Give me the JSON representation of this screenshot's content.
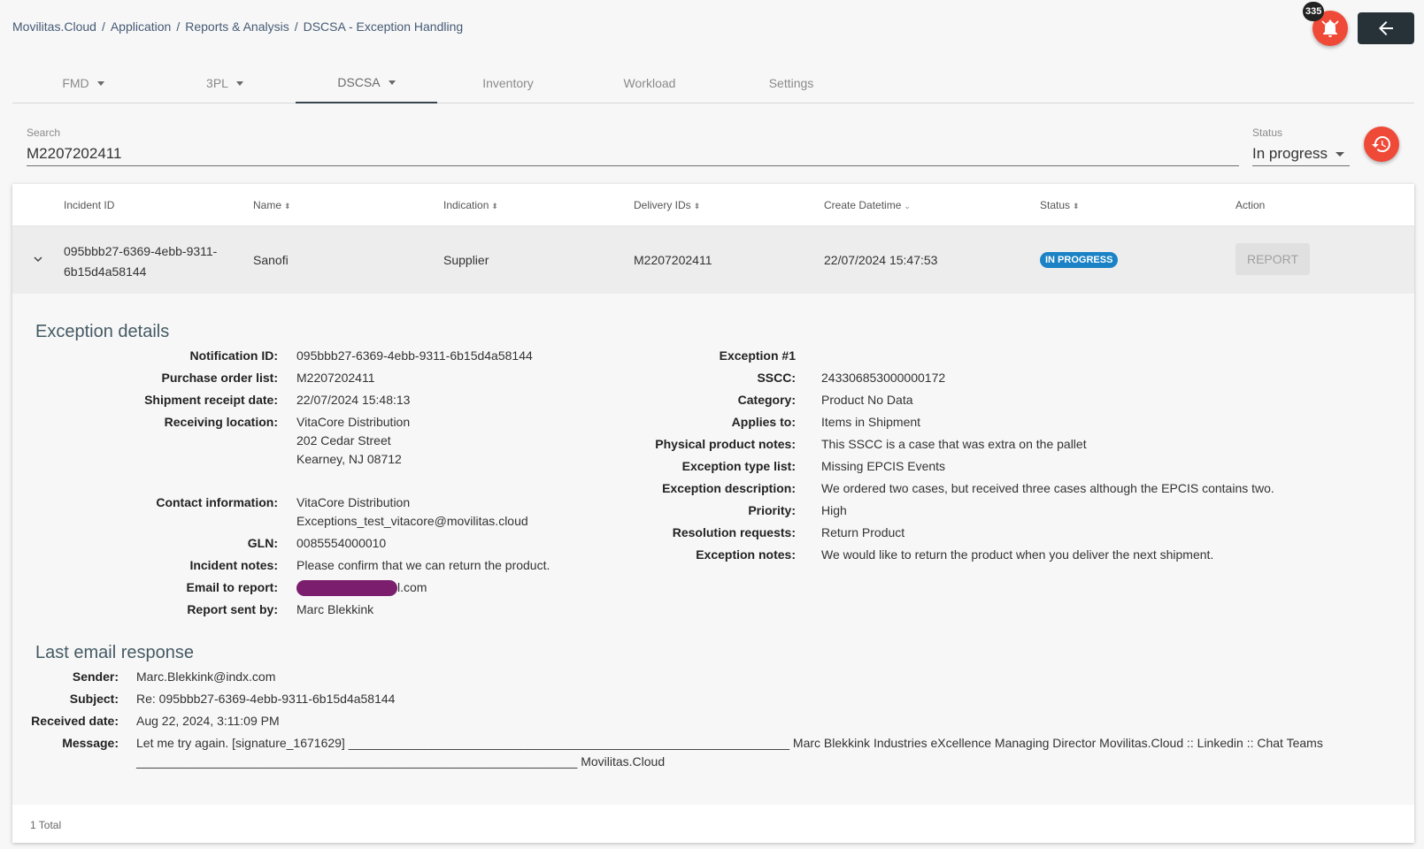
{
  "breadcrumb": [
    "Movilitas.Cloud",
    "Application",
    "Reports & Analysis",
    "DSCSA - Exception Handling"
  ],
  "notifications": {
    "count": "335"
  },
  "tabs": [
    {
      "label": "FMD"
    },
    {
      "label": "3PL"
    },
    {
      "label": "DSCSA"
    },
    {
      "label": "Inventory"
    },
    {
      "label": "Workload"
    },
    {
      "label": "Settings"
    }
  ],
  "search": {
    "label": "Search",
    "value": "M2207202411"
  },
  "status_filter": {
    "label": "Status",
    "value": "In progress"
  },
  "table": {
    "headers": [
      "Incident ID",
      "Name",
      "Indication",
      "Delivery IDs",
      "Create Datetime",
      "Status",
      "Action"
    ],
    "row": {
      "incident_id_line1": "095bbb27-6369-4ebb-9311-",
      "incident_id_line2": "6b15d4a58144",
      "name": "Sanofi",
      "indication": "Supplier",
      "delivery_ids": "M2207202411",
      "create_datetime": "22/07/2024 15:47:53",
      "status": "IN PROGRESS",
      "action": "REPORT"
    }
  },
  "exception_details": {
    "title": "Exception details",
    "left": [
      {
        "label": "Notification ID:",
        "value": "095bbb27-6369-4ebb-9311-6b15d4a58144"
      },
      {
        "label": "Purchase order list:",
        "value": "M2207202411"
      },
      {
        "label": "Shipment receipt date:",
        "value": "22/07/2024 15:48:13"
      },
      {
        "label": "Receiving location:",
        "lines": [
          "VitaCore Distribution",
          "202 Cedar Street",
          "Kearney, NJ 08712"
        ]
      },
      {
        "label": "Contact information:",
        "lines": [
          "VitaCore Distribution",
          "Exceptions_test_vitacore@movilitas.cloud"
        ]
      },
      {
        "label": "GLN:",
        "value": "0085554000010"
      },
      {
        "label": "Incident notes:",
        "value": "Please confirm that we can return the product."
      },
      {
        "label": "Email to report:",
        "value": "l.com"
      },
      {
        "label": "Report sent by:",
        "value": "Marc Blekkink"
      }
    ],
    "right": [
      {
        "label": "Exception #1",
        "value": ""
      },
      {
        "label": "SSCC:",
        "value": "243306853000000172"
      },
      {
        "label": "Category:",
        "value": "Product No Data"
      },
      {
        "label": "Applies to:",
        "value": "Items in Shipment"
      },
      {
        "label": "Physical product notes:",
        "value": "This SSCC is a case that was extra on the pallet"
      },
      {
        "label": "Exception type list:",
        "value": "Missing EPCIS Events"
      },
      {
        "label": "Exception description:",
        "value": "We ordered two cases, but received three cases although the EPCIS contains two."
      },
      {
        "label": "Priority:",
        "value": "High"
      },
      {
        "label": "Resolution requests:",
        "value": "Return Product"
      },
      {
        "label": "Exception notes:",
        "value": "We would like to return the product when you deliver the next shipment."
      }
    ]
  },
  "last_email": {
    "title": "Last email response",
    "fields": [
      {
        "label": "Sender:",
        "value": "Marc.Blekkink@indx.com"
      },
      {
        "label": "Subject:",
        "value": "Re: 095bbb27-6369-4ebb-9311-6b15d4a58144"
      },
      {
        "label": "Received date:",
        "value": "Aug 22, 2024, 3:11:09 PM"
      },
      {
        "label": "Message:",
        "line1": "Let me try again. [signature_1671629] ________________________________________________________________ Marc Blekkink Industries eXcellence Managing Director Movilitas.Cloud :: Linkedin :: Chat Teams",
        "line2": "________________________________________________________________ Movilitas.Cloud"
      }
    ]
  },
  "footer": {
    "total": "1 Total"
  },
  "colors": {
    "accent_red": "#ef4938",
    "badge_blue": "#1a82c5",
    "dark": "#263238"
  }
}
